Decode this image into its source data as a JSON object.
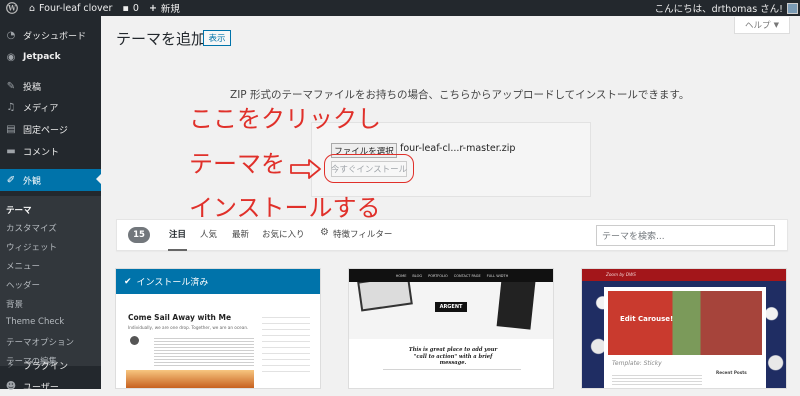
{
  "adminbar": {
    "wp_icon": "wordpress-logo-icon",
    "home_icon": "home-icon",
    "site_name": "Four-leaf clover",
    "comments_icon": "comment-bubble-icon",
    "comments_count": "0",
    "new_icon": "plus-icon",
    "new_label": "新規",
    "greeting": "こんにちは、drthomas さん!"
  },
  "sidebar": {
    "items": [
      {
        "label": "ダッシュボード",
        "icon": "dashboard-icon"
      },
      {
        "label": "Jetpack",
        "icon": "jetpack-icon"
      },
      {
        "label": "投稿",
        "icon": "pin-icon"
      },
      {
        "label": "メディア",
        "icon": "media-icon"
      },
      {
        "label": "固定ページ",
        "icon": "pages-icon"
      },
      {
        "label": "コメント",
        "icon": "comments-icon"
      },
      {
        "label": "外観",
        "icon": "appearance-brush-icon"
      }
    ],
    "submenu": [
      "テーマ",
      "カスタマイズ",
      "ウィジェット",
      "メニュー",
      "ヘッダー",
      "背景",
      "Theme Check",
      "テーマオプション",
      "テーマの編集"
    ],
    "bottom_items": [
      {
        "label": "プラグイン",
        "icon": "plugins-icon"
      },
      {
        "label": "ユーザー",
        "icon": "users-icon"
      }
    ]
  },
  "help_tab": {
    "label": "ヘルプ",
    "icon": "triangle-down-icon"
  },
  "page": {
    "title": "テーマを追加",
    "show_button": "表示"
  },
  "upload": {
    "description": "ZIP 形式のテーマファイルをお持ちの場合、こちらからアップロードしてインストールできます。",
    "choose_file_button": "ファイルを選択",
    "file_name": "four-leaf-cl...r-master.zip",
    "install_button": "今すぐインストール"
  },
  "annotation": {
    "line1": "ここをクリックし",
    "line2": "テーマを",
    "line3": "インストールする",
    "color": "#e0302a"
  },
  "filter": {
    "count": "15",
    "tabs": [
      "注目",
      "人気",
      "最新",
      "お気に入り"
    ],
    "feature_filter": "特徴フィルター",
    "search_placeholder": "テーマを検索..."
  },
  "themes": [
    {
      "installed_label": "インストール済み",
      "preview_title": "Come Sail Away with Me",
      "preview_subtitle": "Individually, we are one drop. Together, we are an ocean."
    },
    {
      "nav": [
        "HOME",
        "BLOG",
        "PORTFOLIO",
        "CONTACT PAGE",
        "FULL WIDTH"
      ],
      "banner": "ARGENT",
      "tagline": "This is great place to add your \"call to action\" with a brief message."
    },
    {
      "header": "Zoom by DWS",
      "slider_text": "Edit Carouse!",
      "post_title": "Template: Sticky",
      "widget_title": "Recent Posts"
    }
  ],
  "colors": {
    "admin_bar": "#23282d",
    "accent": "#0073aa",
    "annotation": "#e0302a"
  }
}
